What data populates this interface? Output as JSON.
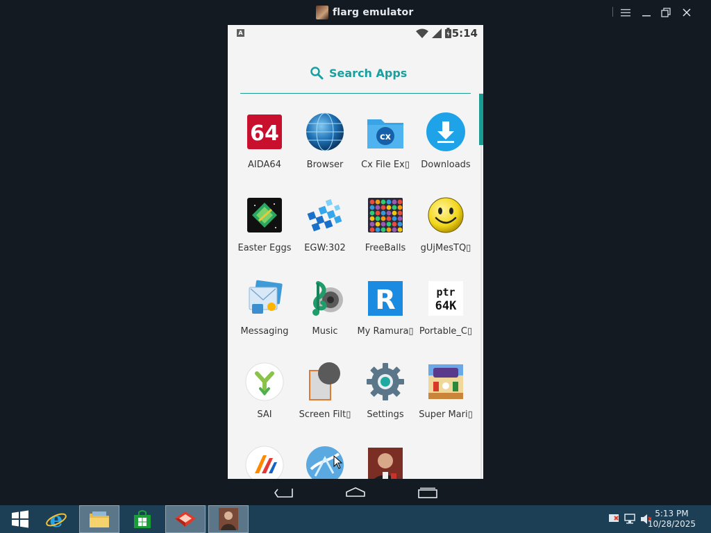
{
  "window": {
    "title": "flarg emulator",
    "icon": "flarg-emulator-icon",
    "controls": [
      "menu-icon",
      "minimize-icon",
      "restore-icon",
      "close-icon"
    ]
  },
  "status_bar": {
    "notification_badge": "A",
    "time": "5:14",
    "icons": [
      "wifi-icon",
      "signal-icon",
      "battery-icon"
    ]
  },
  "search": {
    "label": "Search Apps",
    "icon": "search-icon"
  },
  "apps": [
    {
      "label": "AIDA64",
      "icon": "aida64-icon"
    },
    {
      "label": "Browser",
      "icon": "browser-globe-icon"
    },
    {
      "label": "Cx File Ex▯",
      "icon": "cx-file-explorer-icon"
    },
    {
      "label": "Downloads",
      "icon": "downloads-icon"
    },
    {
      "label": "Easter Eggs",
      "icon": "easter-eggs-icon"
    },
    {
      "label": "EGW:302",
      "icon": "egw-icon"
    },
    {
      "label": "FreeBalls",
      "icon": "freeballs-icon"
    },
    {
      "label": "gUjMesTQ▯",
      "icon": "smiley-icon"
    },
    {
      "label": "Messaging",
      "icon": "messaging-icon"
    },
    {
      "label": "Music",
      "icon": "music-icon"
    },
    {
      "label": "My Ramura▯",
      "icon": "my-ramura-icon"
    },
    {
      "label": "Portable_C▯",
      "icon": "portable-c-icon"
    },
    {
      "label": "SAI",
      "icon": "sai-icon"
    },
    {
      "label": "Screen Filt▯",
      "icon": "screen-filter-icon"
    },
    {
      "label": "Settings",
      "icon": "settings-gear-icon"
    },
    {
      "label": "Super Mari▯",
      "icon": "super-mario-icon"
    },
    {
      "label": "",
      "icon": "vanced-icon"
    },
    {
      "label": "",
      "icon": "blue-app-icon"
    },
    {
      "label": "",
      "icon": "photo-person-icon"
    }
  ],
  "icon_text": {
    "aida64": "64",
    "cx": "cx",
    "ramura": "R",
    "portable_line1": "ptr",
    "portable_line2": "64K"
  },
  "nav_bar": {
    "buttons": [
      "back-icon",
      "home-icon",
      "recents-icon"
    ]
  },
  "taskbar": {
    "apps": [
      "windows-start-icon",
      "internet-explorer-icon",
      "file-explorer-icon",
      "store-icon",
      "red-app-icon",
      "flarg-emulator-icon"
    ],
    "clock_time": "5:13 PM",
    "clock_date": "10/28/2025",
    "tray": [
      "action-center-icon",
      "network-icon",
      "volume-muted-icon"
    ]
  },
  "colors": {
    "accent": "#1a9b8f",
    "search_text": "#17a0a0",
    "taskbar": "#1d3f56",
    "emulator_bg": "#141a22"
  }
}
